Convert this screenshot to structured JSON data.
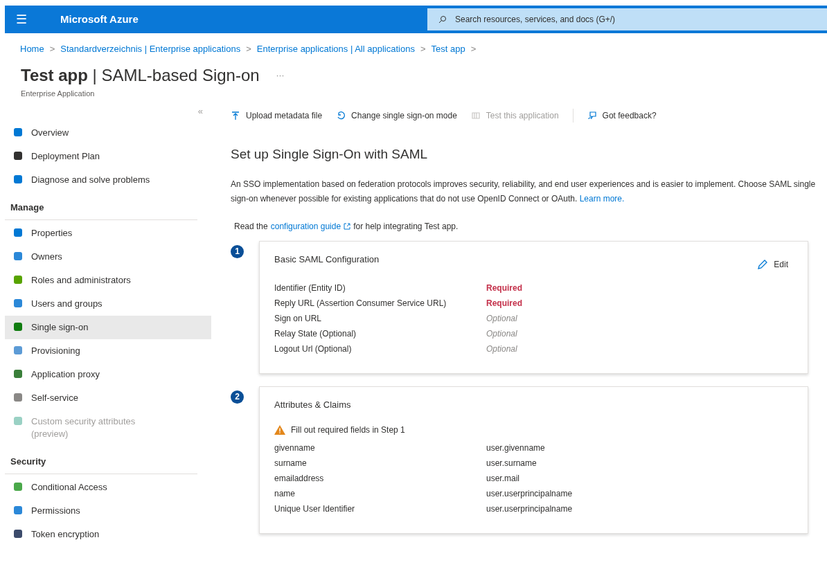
{
  "topbar": {
    "menu_glyph": "☰",
    "brand": "Microsoft Azure",
    "search": {
      "placeholder": "Search resources, services, and docs (G+/)"
    }
  },
  "breadcrumb": [
    "Home",
    "Standardverzeichnis | Enterprise applications",
    "Enterprise applications | All applications",
    "Test app"
  ],
  "breadcrumb_separator": ">",
  "page": {
    "title_bold": "Test app",
    "title_rest": "| SAML-based Sign-on",
    "more": "···",
    "subtitle": "Enterprise Application"
  },
  "sidebar": {
    "collapse": "«",
    "items": [
      {
        "kind": "link",
        "label": "Overview",
        "selected": false,
        "disabled": false
      },
      {
        "kind": "link",
        "label": "Deployment Plan",
        "selected": false,
        "disabled": false
      },
      {
        "kind": "link",
        "label": "Diagnose and solve problems",
        "selected": false,
        "disabled": false
      },
      {
        "kind": "header",
        "label": "Manage"
      },
      {
        "kind": "link",
        "label": "Properties",
        "selected": false,
        "disabled": false
      },
      {
        "kind": "link",
        "label": "Owners",
        "selected": false,
        "disabled": false
      },
      {
        "kind": "link",
        "label": "Roles and administrators",
        "selected": false,
        "disabled": false
      },
      {
        "kind": "link",
        "label": "Users and groups",
        "selected": false,
        "disabled": false
      },
      {
        "kind": "link",
        "label": "Single sign-on",
        "selected": true,
        "disabled": false
      },
      {
        "kind": "link",
        "label": "Provisioning",
        "selected": false,
        "disabled": false
      },
      {
        "kind": "link",
        "label": "Application proxy",
        "selected": false,
        "disabled": false
      },
      {
        "kind": "link",
        "label": "Self-service",
        "selected": false,
        "disabled": false
      },
      {
        "kind": "link",
        "label": "Custom security attributes (preview)",
        "selected": false,
        "disabled": true
      },
      {
        "kind": "header",
        "label": "Security"
      },
      {
        "kind": "link",
        "label": "Conditional Access",
        "selected": false,
        "disabled": false
      },
      {
        "kind": "link",
        "label": "Permissions",
        "selected": false,
        "disabled": false
      },
      {
        "kind": "link",
        "label": "Token encryption",
        "selected": false,
        "disabled": false
      }
    ]
  },
  "toolbar": [
    {
      "label": "Upload metadata file",
      "disabled": false
    },
    {
      "label": "Change single sign-on mode",
      "disabled": false
    },
    {
      "label": "Test this application",
      "disabled": true
    },
    {
      "label": "Got feedback?",
      "disabled": false
    }
  ],
  "heading": "Set up Single Sign-On with SAML",
  "intro": "An SSO implementation based on federation protocols improves security, reliability, and end user experiences and is easier to implement. Choose SAML single sign-on whenever possible for existing applications that do not use OpenID Connect or OAuth.",
  "intro_link": "Learn more.",
  "guide": {
    "before": "Read the",
    "link": "configuration guide",
    "after": "for help integrating Test app."
  },
  "steps": [
    {
      "number": "1",
      "title": "Basic SAML Configuration",
      "edit": "Edit",
      "rows": [
        {
          "label": "Identifier (Entity ID)",
          "value": "Required",
          "kind": "required"
        },
        {
          "label": "Reply URL (Assertion Consumer Service URL)",
          "value": "Required",
          "kind": "required"
        },
        {
          "label": "Sign on URL",
          "value": "Optional",
          "kind": "optional"
        },
        {
          "label": "Relay State (Optional)",
          "value": "Optional",
          "kind": "optional"
        },
        {
          "label": "Logout Url (Optional)",
          "value": "Optional",
          "kind": "optional"
        }
      ]
    },
    {
      "number": "2",
      "title": "Attributes & Claims",
      "warning": "Fill out required fields in Step 1",
      "rows": [
        {
          "label": "givenname",
          "value": "user.givenname",
          "kind": "plain"
        },
        {
          "label": "surname",
          "value": "user.surname",
          "kind": "plain"
        },
        {
          "label": "emailaddress",
          "value": "user.mail",
          "kind": "plain"
        },
        {
          "label": "name",
          "value": "user.userprincipalname",
          "kind": "plain"
        },
        {
          "label": "Unique User Identifier",
          "value": "user.userprincipalname",
          "kind": "plain"
        }
      ]
    }
  ]
}
